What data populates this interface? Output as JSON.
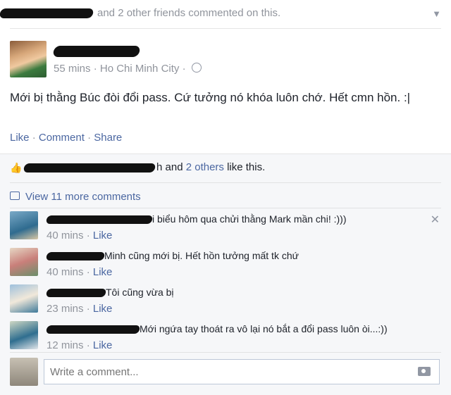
{
  "story": {
    "header_suffix": "and 2 other friends commented on this."
  },
  "post": {
    "time": "55 mins",
    "sep": " · ",
    "location": "Ho Chi Minh City",
    "text": "Mới bị thằng Búc đòi đổi pass. Cứ tưởng nó khóa luôn chớ. Hết cmn hồn. :|",
    "actions": {
      "like": "Like",
      "comment": "Comment",
      "share": "Share",
      "dot": " · "
    }
  },
  "likes": {
    "tail": "h and",
    "others": "2 others",
    "suffix": "like this."
  },
  "comments_section": {
    "view_more": "View 11 more comments"
  },
  "comments": [
    {
      "text": "i biểu hôm qua chửi thằng Mark mần chi! :)))",
      "time": "40 mins",
      "like": "Like"
    },
    {
      "text": "Minh cũng mới bị. Hết hồn tưởng mất tk chứ",
      "time": "40 mins",
      "like": "Like"
    },
    {
      "text": "Tôi cũng vừa bị",
      "time": "23 mins",
      "like": "Like"
    },
    {
      "text": "Mới ngứa tay thoát ra vô lại nó bắt a đổi pass luôn òi...:))",
      "time": "12 mins",
      "like": "Like"
    }
  ],
  "composer": {
    "placeholder": "Write a comment..."
  },
  "colors": {
    "link": "#4b67a1",
    "muted": "#90949c",
    "ufi_bg": "#f6f7f9"
  },
  "icons": [
    "chevron-down-icon",
    "globe-icon",
    "thumbs-up-icon",
    "comment-bubble-icon",
    "close-icon",
    "camera-icon"
  ]
}
